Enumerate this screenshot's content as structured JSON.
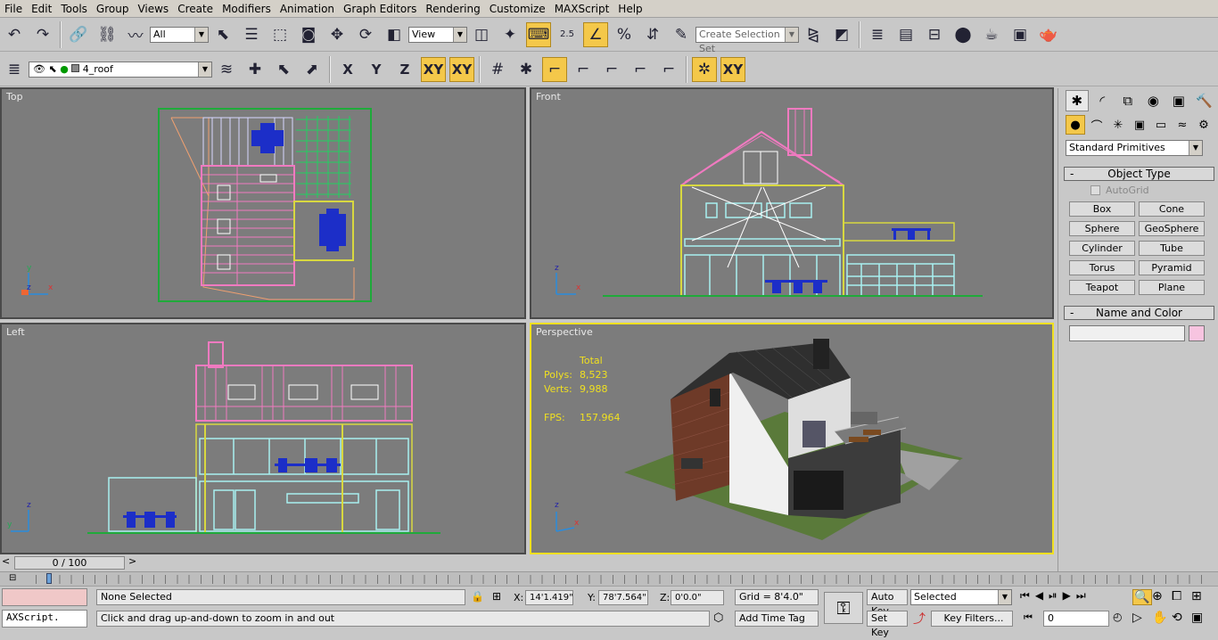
{
  "menu": [
    "File",
    "Edit",
    "Tools",
    "Group",
    "Views",
    "Create",
    "Modifiers",
    "Animation",
    "Graph Editors",
    "Rendering",
    "Customize",
    "MAXScript",
    "Help"
  ],
  "toolbar": {
    "filter_value": "All",
    "refcoord_value": "View",
    "snap_angle_label": "2.5",
    "selection_set_placeholder": "Create Selection Set",
    "axis_x": "X",
    "axis_y": "Y",
    "axis_z": "Z",
    "axis_xy": "XY",
    "axis_xy2": "XY"
  },
  "layer": {
    "name": "4_roof"
  },
  "viewports": {
    "top": "Top",
    "front": "Front",
    "left": "Left",
    "perspective": "Perspective"
  },
  "stats": {
    "header": "Total",
    "polys_label": "Polys:",
    "polys_value": "8,523",
    "verts_label": "Verts:",
    "verts_value": "9,988",
    "fps_label": "FPS:",
    "fps_value": "157.964"
  },
  "gizmo": {
    "x": "x",
    "y": "y",
    "z": "z"
  },
  "command_panel": {
    "category_value": "Standard Primitives",
    "object_type_header": "Object Type",
    "autogrid_label": "AutoGrid",
    "buttons": [
      "Box",
      "Cone",
      "Sphere",
      "GeoSphere",
      "Cylinder",
      "Tube",
      "Torus",
      "Pyramid",
      "Teapot",
      "Plane"
    ],
    "name_color_header": "Name and Color",
    "swatch_color": "#f7c4e0"
  },
  "timeline": {
    "slider_label": "0 / 100",
    "progress": 0
  },
  "status": {
    "maxscript_label": "AXScript.",
    "selection_text": "None Selected",
    "prompt_text": "Click and drag up-and-down to zoom in and out",
    "x_label": "X:",
    "x_value": "14'1.419\"",
    "y_label": "Y:",
    "y_value": "78'7.564\"",
    "z_label": "Z:",
    "z_value": "0'0.0\"",
    "grid_text": "Grid = 8'4.0\"",
    "add_time_tag": "Add Time Tag",
    "auto_key": "Auto Key",
    "set_key": "Set Key",
    "key_mode_value": "Selected",
    "key_filters": "Key Filters...",
    "frame_value": "0"
  }
}
